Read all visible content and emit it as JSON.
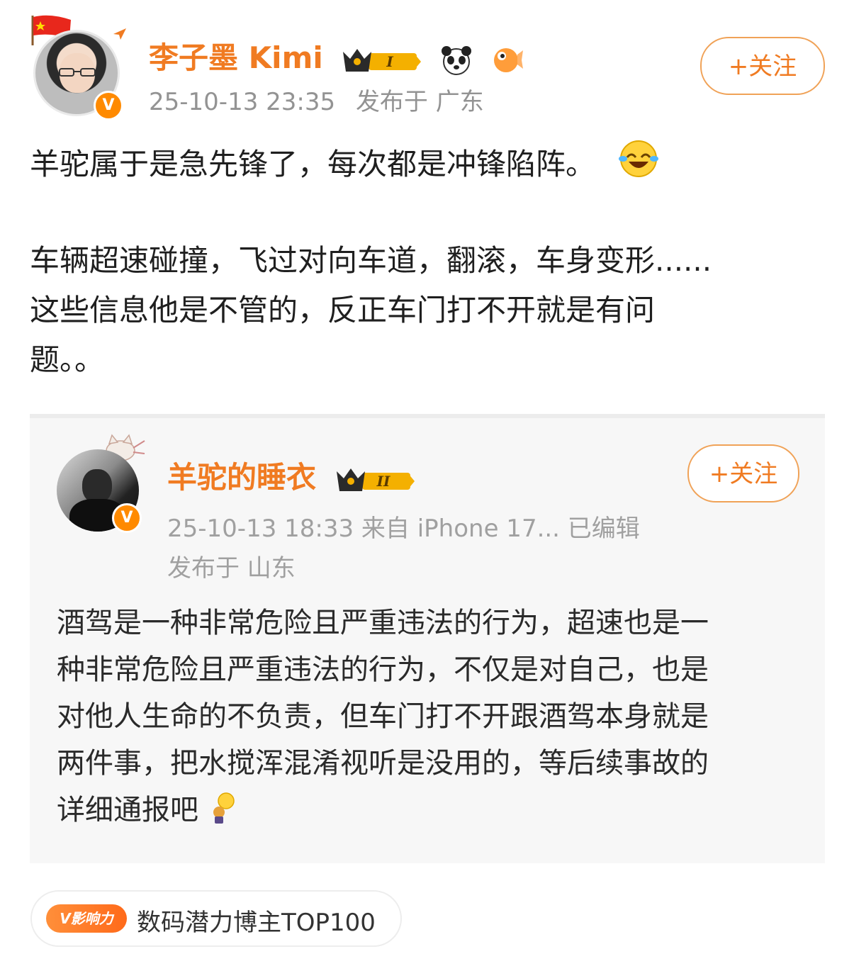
{
  "post": {
    "author": {
      "name": "李子墨 Kimi",
      "level_badge": "I",
      "verified_badge": "V"
    },
    "timestamp": "25-10-13 23:35",
    "location": "发布于 广东",
    "follow_label": "+关注",
    "paragraphs": [
      [
        "羊驼属于是急先锋了，每次都是冲锋陷阵。"
      ],
      [
        "车辆超速碰撞，飞过对向车道，翻滚，车身变形......",
        "这些信息他是不管的，反正车门打不开就是有问",
        "题。。"
      ]
    ]
  },
  "repost": {
    "author": {
      "name": "羊驼的睡衣",
      "level_badge": "II",
      "verified_badge": "V"
    },
    "meta_line1": "25-10-13 18:33  来自 iPhone 17...  已编辑",
    "meta_line2": "发布于 山东",
    "follow_label": "+关注",
    "lines": [
      "酒驾是一种非常危险且严重违法的行为，超速也是一",
      "种非常危险且严重违法的行为，不仅是对自己，也是",
      "对他人生命的不负责，但车门打不开跟酒驾本身就是",
      "两件事，把水搅浑混淆视听是没用的，等后续事故的",
      "详细通报吧"
    ]
  },
  "influence_tag": {
    "badge": "V影响力",
    "text": "数码潜力博主TOP100"
  },
  "icons": {
    "flag": "china-flag-icon",
    "emoji_cry_laugh": "laugh-cry-emoji-icon",
    "emoji_bulb": "lightbulb-emoji-icon",
    "panda": "panda-icon",
    "pufferfish": "pufferfish-icon"
  },
  "colors": {
    "accent": "#f07b22",
    "meta": "#939393",
    "card_bg": "#f7f7f7"
  }
}
